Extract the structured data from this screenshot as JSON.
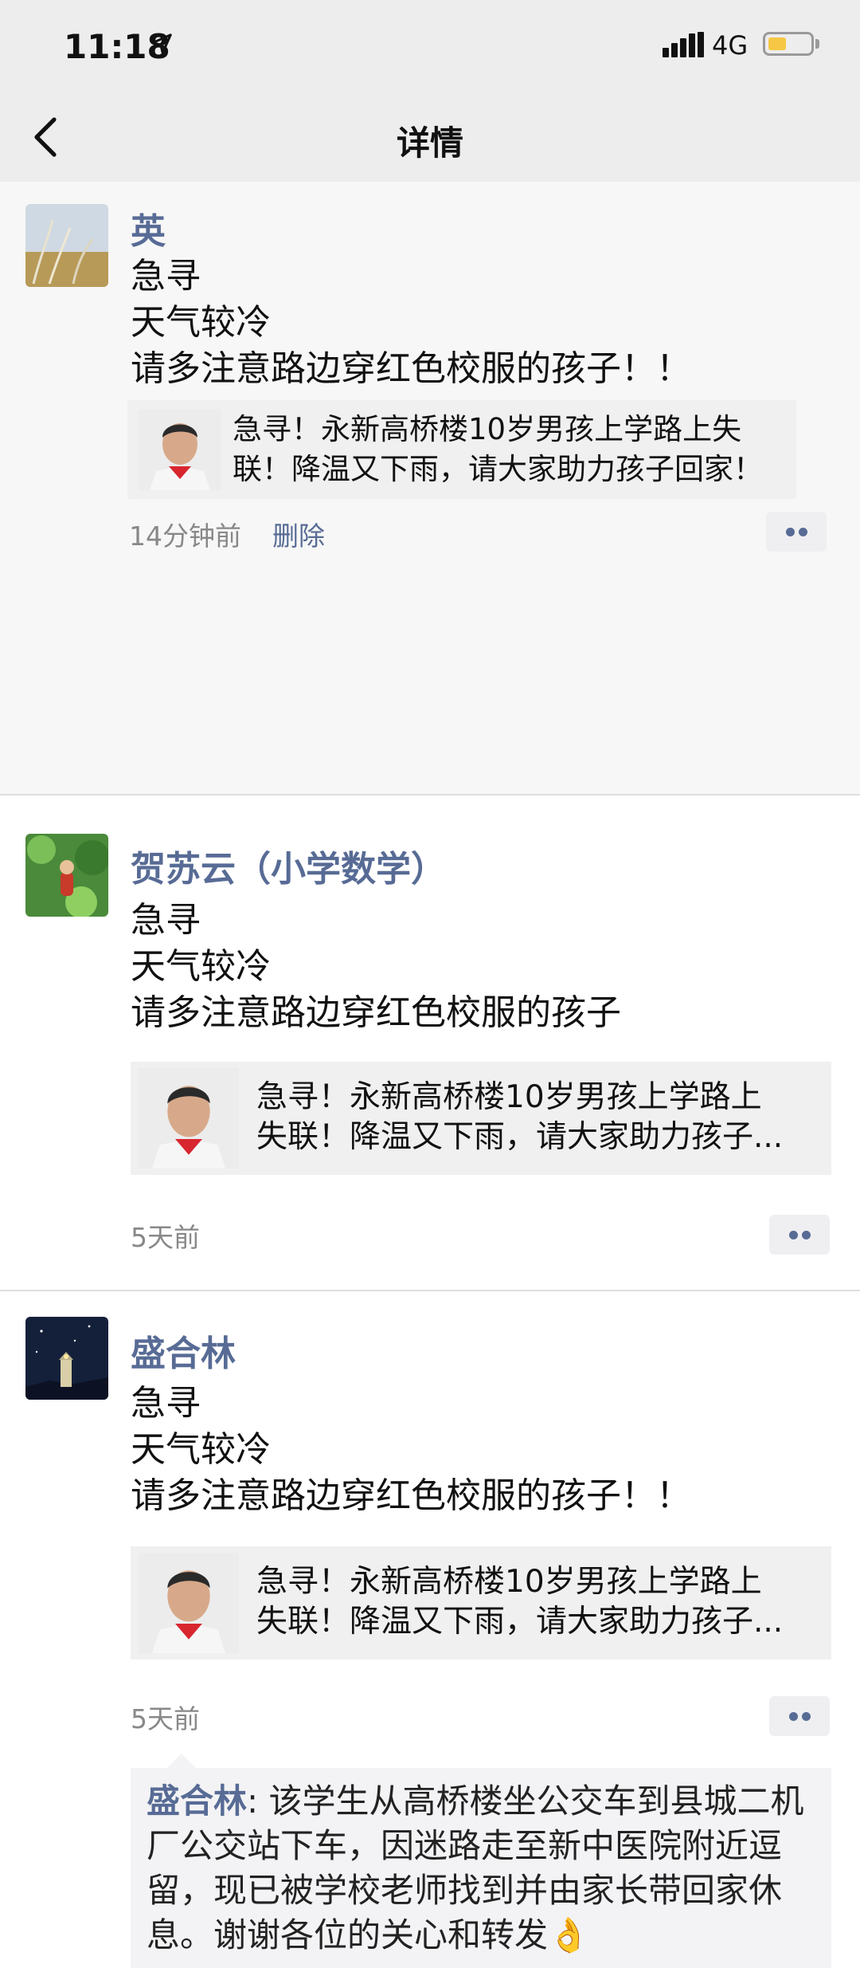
{
  "status_bar": {
    "time": "11:18",
    "network": "4G"
  },
  "nav": {
    "title": "详情"
  },
  "posts": [
    {
      "author": "英",
      "lines": [
        "急寻",
        "天气较冷",
        "请多注意路边穿红色校服的孩子！！"
      ],
      "link": {
        "title_lines": [
          "急寻！永新高桥楼10岁男孩上学路上失",
          "联！降温又下雨，请大家助力孩子回家！"
        ]
      },
      "time": "14分钟前",
      "delete": "删除"
    },
    {
      "author": "贺苏云（小学数学）",
      "lines": [
        "急寻",
        "天气较冷",
        "请多注意路边穿红色校服的孩子"
      ],
      "link": {
        "title_lines": [
          "急寻！永新高桥楼10岁男孩上学路上",
          "失联！降温又下雨，请大家助力孩子..."
        ]
      },
      "time": "5天前"
    },
    {
      "author": "盛合林",
      "lines": [
        "急寻",
        "天气较冷",
        "请多注意路边穿红色校服的孩子！！"
      ],
      "link": {
        "title_lines": [
          "急寻！永新高桥楼10岁男孩上学路上",
          "失联！降温又下雨，请大家助力孩子..."
        ]
      },
      "time": "5天前",
      "comment": {
        "author": "盛合林",
        "text": ": 该学生从高桥楼坐公交车到县城二机厂公交站下车，因迷路走至新中医院附近逗留，现已被学校老师找到并由家长带回家休息。谢谢各位的关心和转发👌"
      }
    }
  ],
  "icons": {
    "back": "chevron-left-icon",
    "more": "more-dots-icon",
    "location": "location-arrow-icon",
    "signal": "signal-bars-icon",
    "battery": "battery-icon"
  },
  "colors": {
    "name_blue": "#576b95",
    "battery_yellow": "#f6c744",
    "nav_bg": "#ededed"
  }
}
